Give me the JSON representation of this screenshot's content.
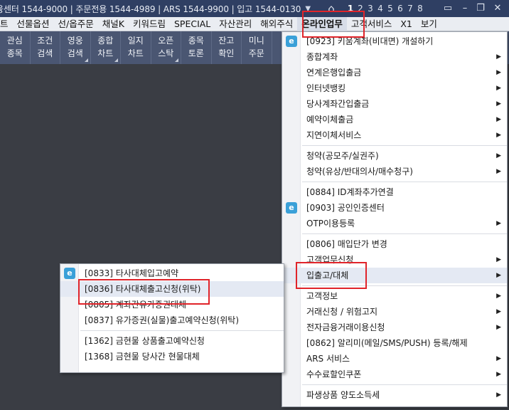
{
  "titlebar": {
    "phones": "융센터 1544-9000 | 주문전용 1544-4989 | ARS 1544-9900 | 입고 1544-0130",
    "dropdown_icon": "chevron-down-icon",
    "home_icon": "home-icon",
    "pages": [
      "1",
      "2",
      "3",
      "4",
      "5",
      "6",
      "7",
      "8"
    ],
    "active_page": "1",
    "window_buttons": [
      "monitor-icon",
      "minimize-icon",
      "restore-icon",
      "close-icon"
    ]
  },
  "menubar": {
    "items": [
      "트",
      "선물옵션",
      "선/옵주문",
      "채널K",
      "키워드림",
      "SPECIAL",
      "자산관리",
      "해외주식",
      "온라인업무",
      "고객서비스",
      "X1",
      "보기"
    ],
    "open_item": "온라인업무"
  },
  "toolbar": {
    "buttons": [
      {
        "line1": "관심",
        "line2": "종목"
      },
      {
        "line1": "조건",
        "line2": "검색"
      },
      {
        "line1": "영웅",
        "line2": "검색"
      },
      {
        "line1": "종합",
        "line2": "차트"
      },
      {
        "line1": "일지",
        "line2": "차트"
      },
      {
        "line1": "오픈",
        "line2": "스탁"
      },
      {
        "line1": "종목",
        "line2": "토론"
      },
      {
        "line1": "잔고",
        "line2": "확인"
      },
      {
        "line1": "미니",
        "line2": "주문"
      }
    ]
  },
  "main_menu": {
    "items": [
      {
        "label": "[0923] 키움계좌(비대면) 개설하기",
        "icon": true,
        "arrow": false
      },
      {
        "label": "종합계좌",
        "arrow": true
      },
      {
        "label": "연계은행입출금",
        "arrow": true
      },
      {
        "label": "인터넷뱅킹",
        "arrow": true
      },
      {
        "label": "당사계좌간입출금",
        "arrow": true
      },
      {
        "label": "예약이체출금",
        "arrow": true
      },
      {
        "label": "지연이체서비스",
        "arrow": true
      },
      {
        "sep": true
      },
      {
        "label": "청약(공모주/실권주)",
        "arrow": true
      },
      {
        "label": "청약(유상/반대의사/매수청구)",
        "arrow": true
      },
      {
        "sep": true
      },
      {
        "label": "[0884] ID계좌추가연결",
        "arrow": false
      },
      {
        "label": "[0903] 공인인증센터",
        "icon": true,
        "arrow": false
      },
      {
        "label": "OTP이용등록",
        "arrow": true
      },
      {
        "sep": true
      },
      {
        "label": "[0806] 매입단가 변경",
        "arrow": false
      },
      {
        "label": "고객업무신청",
        "arrow": true
      },
      {
        "label": "입출고/대체",
        "arrow": true,
        "hl": true
      },
      {
        "sep": true
      },
      {
        "label": "고객정보",
        "arrow": true
      },
      {
        "label": "거래신청 / 위험고지",
        "arrow": true
      },
      {
        "label": "전자금융거래이용신청",
        "arrow": true
      },
      {
        "label": "[0862] 알리미(메일/SMS/PUSH) 등록/해제",
        "arrow": false
      },
      {
        "label": "ARS 서비스",
        "arrow": true
      },
      {
        "label": "수수료할인쿠폰",
        "arrow": true
      },
      {
        "sep": true
      },
      {
        "label": "파생상품 양도소득세",
        "arrow": true
      }
    ]
  },
  "sub_menu": {
    "items": [
      {
        "label": "[0833] 타사대체입고예약",
        "icon": true
      },
      {
        "label": "[0836] 타사대체출고신청(위탁)",
        "hl": true
      },
      {
        "label": "[0805] 계좌간유가증권대체"
      },
      {
        "label": "[0837] 유가증권(실물)출고예약신청(위탁)"
      },
      {
        "sep": true
      },
      {
        "label": "[1362] 금현물 상품출고예약신청"
      },
      {
        "label": "[1368] 금현물 당사간 현물대체"
      }
    ]
  },
  "colors": {
    "titlebar": "#2f3f63",
    "toolbar": "#4a5672",
    "workspace": "#3a3d44",
    "highlight_box": "#e0242a"
  }
}
